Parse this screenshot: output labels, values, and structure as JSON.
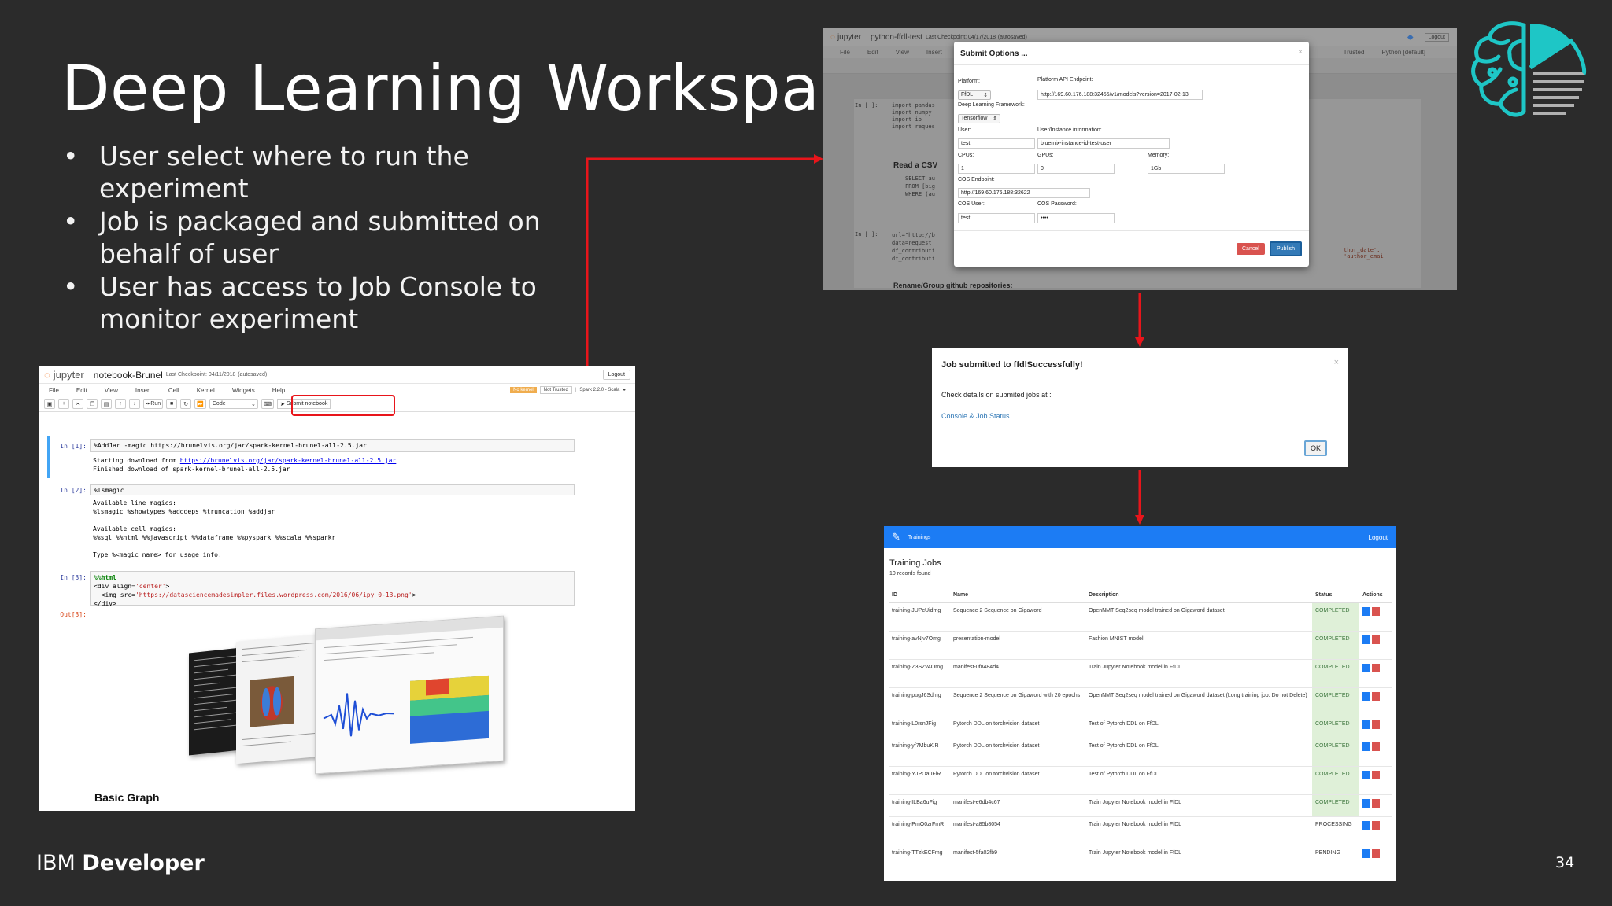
{
  "slide": {
    "title": "Deep Learning Workspace",
    "bullets": [
      "User select where to run the experiment",
      "Job is packaged and submitted on behalf of user",
      "User has access to Job Console to monitor experiment"
    ],
    "brand_regular": "IBM ",
    "brand_bold": "Developer",
    "page_number": "34",
    "bullet_char": "•",
    "accent_red": "#e8151b",
    "logo_color": "#1ec6c6"
  },
  "notebook": {
    "app": "jupyter",
    "name": "notebook-Brunel",
    "checkpoint": "Last Checkpoint: 04/11/2018",
    "autosaved": "(autosaved)",
    "logout": "Logout",
    "menu": [
      "File",
      "Edit",
      "View",
      "Insert",
      "Cell",
      "Kernel",
      "Widgets",
      "Help"
    ],
    "kernel_badge": "No kernel",
    "trust": "Not Trusted",
    "kernel_name": "Spark 2.2.0 - Scala",
    "run_label": "Run",
    "cell_type": "Code",
    "submit_label": "Submit notebook",
    "cells": [
      {
        "prompt": "In [1]:",
        "code": "%AddJar -magic https://brunelvis.org/jar/spark-kernel-brunel-all-2.5.jar",
        "out1": "Starting download from ",
        "out1_url": "https://brunelvis.org/jar/spark-kernel-brunel-all-2.5.jar",
        "out2": "Finished download of spark-kernel-brunel-all-2.5.jar"
      },
      {
        "prompt": "In [2]:",
        "code": "%lsmagic",
        "output": "Available line magics:\n%lsmagic %showtypes %adddeps %truncation %addjar\n\nAvailable cell magics:\n%%sql %%html %%javascript %%dataframe %%pyspark %%scala %%sparkr\n\nType %<magic_name> for usage info."
      },
      {
        "prompt": "In [3]:",
        "line1": "%%html",
        "line2a": "<div align=",
        "line2b": "'center'",
        "line2c": ">",
        "line3a": "  <img src=",
        "line3b": "'https://datasciencemadesimpler.files.wordpress.com/2016/06/ipy_0-13.png'",
        "line3c": ">",
        "line4": "</div>"
      },
      {
        "prompt": "Out[3]:"
      }
    ],
    "basic_graph": "Basic Graph"
  },
  "submit_options": {
    "bg_app": "jupyter",
    "bg_name": "python-ffdl-test",
    "bg_checkpoint": "Last Checkpoint: 04/17/2018",
    "bg_autosaved": "(autosaved)",
    "bg_logout": "Logout",
    "bg_menu": [
      "File",
      "Edit",
      "View",
      "Insert"
    ],
    "bg_trusted": "Trusted",
    "bg_kernel": "Python [default]",
    "bg_cell_prompt": "In [ ]:",
    "bg_code": [
      "import pandas",
      "import numpy",
      "import io",
      "import reques"
    ],
    "bg_read_csv": "Read a CSV",
    "bg_sql": [
      "SELECT au",
      "FROM [big",
      "WHERE (au"
    ],
    "bg_cell2": [
      "url=\"http://b",
      "data=request",
      "df_contributi",
      "df_contributi"
    ],
    "bg_right_code": "thor_date', 'author_emai",
    "bg_rename": "Rename/Group github repositories:",
    "title": "Submit Options ...",
    "close": "×",
    "platform_label": "Platform:",
    "platform_value": "FfDL",
    "api_label": "Platform API Endpoint:",
    "api_value": "http://169.60.176.188:32455/v1/models?version=2017-02-13",
    "framework_label": "Deep Learning Framework:",
    "framework_value": "Tensorflow",
    "user_label": "User:",
    "user_value": "test",
    "instance_label": "User/Instance information:",
    "instance_value": "bluemix-instance-id-test-user",
    "cpus_label": "CPUs:",
    "cpus_value": "1",
    "gpus_label": "GPUs:",
    "gpus_value": "0",
    "memory_label": "Memory:",
    "memory_value": "1Gb",
    "cos_endpoint_label": "COS Endpoint:",
    "cos_endpoint_value": "http://169.60.176.188:32622",
    "cos_user_label": "COS User:",
    "cos_user_value": "test",
    "cos_password_label": "COS Password:",
    "cos_password_value": "••••",
    "cancel": "Cancel",
    "publish": "Publish"
  },
  "job_submitted": {
    "title": "Job submitted to ffdlSuccessfully!",
    "close": "×",
    "details": "Check details on submited jobs at :",
    "link": "Console & Job Status",
    "ok": "OK"
  },
  "trainings": {
    "nav_title": "Trainings",
    "logout": "Logout",
    "heading": "Training Jobs",
    "count": "10 records found",
    "columns": [
      "ID",
      "Name",
      "Description",
      "Status",
      "Actions"
    ],
    "rows": [
      {
        "id": "training-JUPcUidmg",
        "name": "Sequence 2 Sequence on Gigaword",
        "desc": "OpenNMT Seq2seq model trained on Gigaword dataset",
        "status": "COMPLETED"
      },
      {
        "id": "training-avNjv7Omg",
        "name": "presentation-model",
        "desc": "Fashion MNIST model",
        "status": "COMPLETED"
      },
      {
        "id": "training-Z3SZv4Omg",
        "name": "manifest-0f8484d4",
        "desc": "Train Jupyter Notebook model in FfDL",
        "status": "COMPLETED"
      },
      {
        "id": "training-pugJ6Sdmg",
        "name": "Sequence 2 Sequence on Gigaword with 20 epochs",
        "desc": "OpenNMT Seq2seq model trained on Gigaword dataset (Long training job. Do not Delete)",
        "status": "COMPLETED"
      },
      {
        "id": "training-L0rsnJFig",
        "name": "Pytorch DDL on torchvision dataset",
        "desc": "Test of Pytorch DDL on FfDL",
        "status": "COMPLETED"
      },
      {
        "id": "training-yf7MbuKiR",
        "name": "Pytorch DDL on torchvision dataset",
        "desc": "Test of Pytorch DDL on FfDL",
        "status": "COMPLETED"
      },
      {
        "id": "training-YJPOauFiR",
        "name": "Pytorch DDL on torchvision dataset",
        "desc": "Test of Pytorch DDL on FfDL",
        "status": "COMPLETED"
      },
      {
        "id": "training-ILBa6uFig",
        "name": "manifest-e6db4c67",
        "desc": "Train Jupyter Notebook model in FfDL",
        "status": "COMPLETED"
      },
      {
        "id": "training-PmO0zrFmR",
        "name": "manifest-a85b8054",
        "desc": "Train Jupyter Notebook model in FfDL",
        "status": "PROCESSING"
      },
      {
        "id": "training-TTzkECFmg",
        "name": "manifest-5fa02fb9",
        "desc": "Train Jupyter Notebook model in FfDL",
        "status": "PENDING"
      }
    ]
  }
}
